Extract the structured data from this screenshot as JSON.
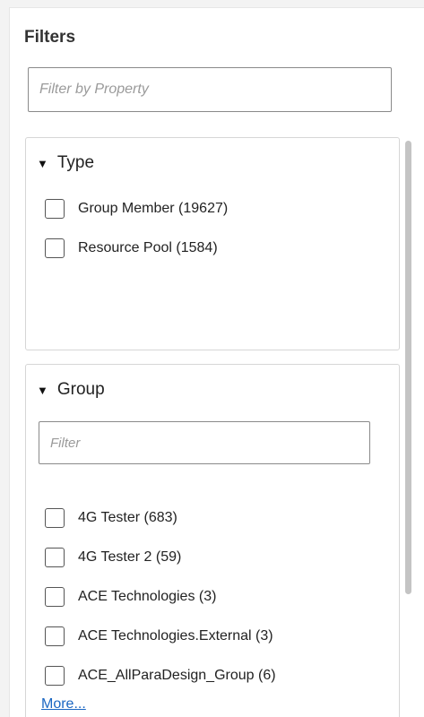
{
  "filters": {
    "title": "Filters",
    "property_filter_placeholder": "Filter by Property"
  },
  "type_section": {
    "header": "Type",
    "items": [
      {
        "label": "Group Member (19627)",
        "checked": false
      },
      {
        "label": "Resource Pool (1584)",
        "checked": false
      }
    ]
  },
  "group_section": {
    "header": "Group",
    "filter_placeholder": "Filter",
    "items": [
      {
        "label": "4G Tester (683)",
        "checked": false
      },
      {
        "label": "4G Tester 2 (59)",
        "checked": false
      },
      {
        "label": "ACE Technologies (3)",
        "checked": false
      },
      {
        "label": "ACE Technologies.External (3)",
        "checked": false
      },
      {
        "label": "ACE_AllParaDesign_Group (6)",
        "checked": false
      }
    ],
    "more_link": "More..."
  },
  "icons": {
    "collapse": "triangle-down-icon"
  },
  "colors": {
    "link": "#1a66c2",
    "border": "#d6d6d6"
  }
}
